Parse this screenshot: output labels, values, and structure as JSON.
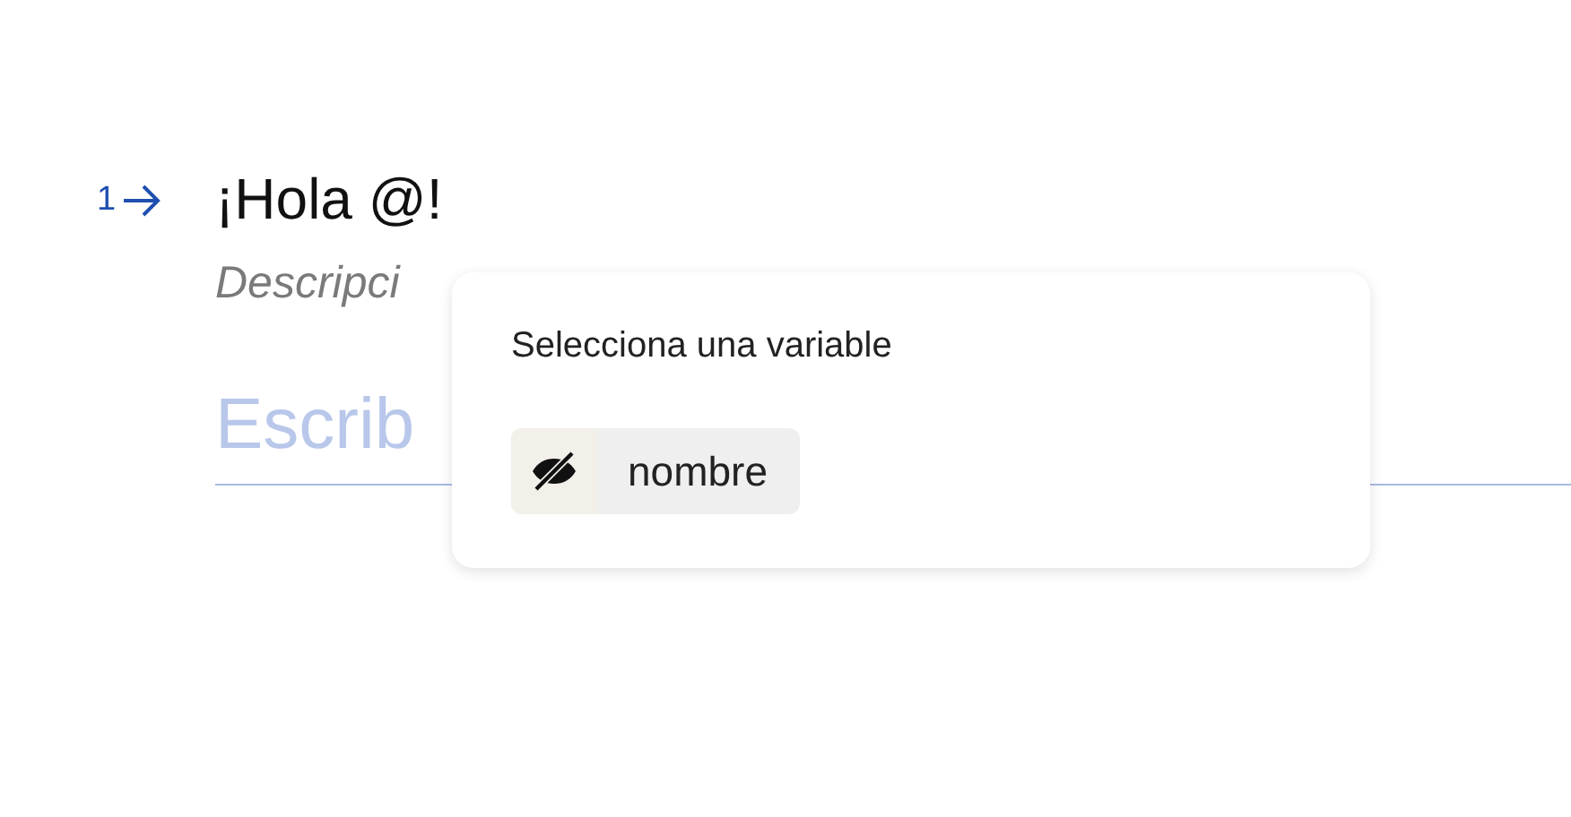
{
  "question": {
    "number": "1",
    "title": "¡Hola @!",
    "description": "Descripci",
    "answer": {
      "placeholder": "Escrib"
    }
  },
  "variable_menu": {
    "title": "Selecciona una variable",
    "options": [
      {
        "label": "nombre",
        "selected": false
      }
    ]
  }
}
